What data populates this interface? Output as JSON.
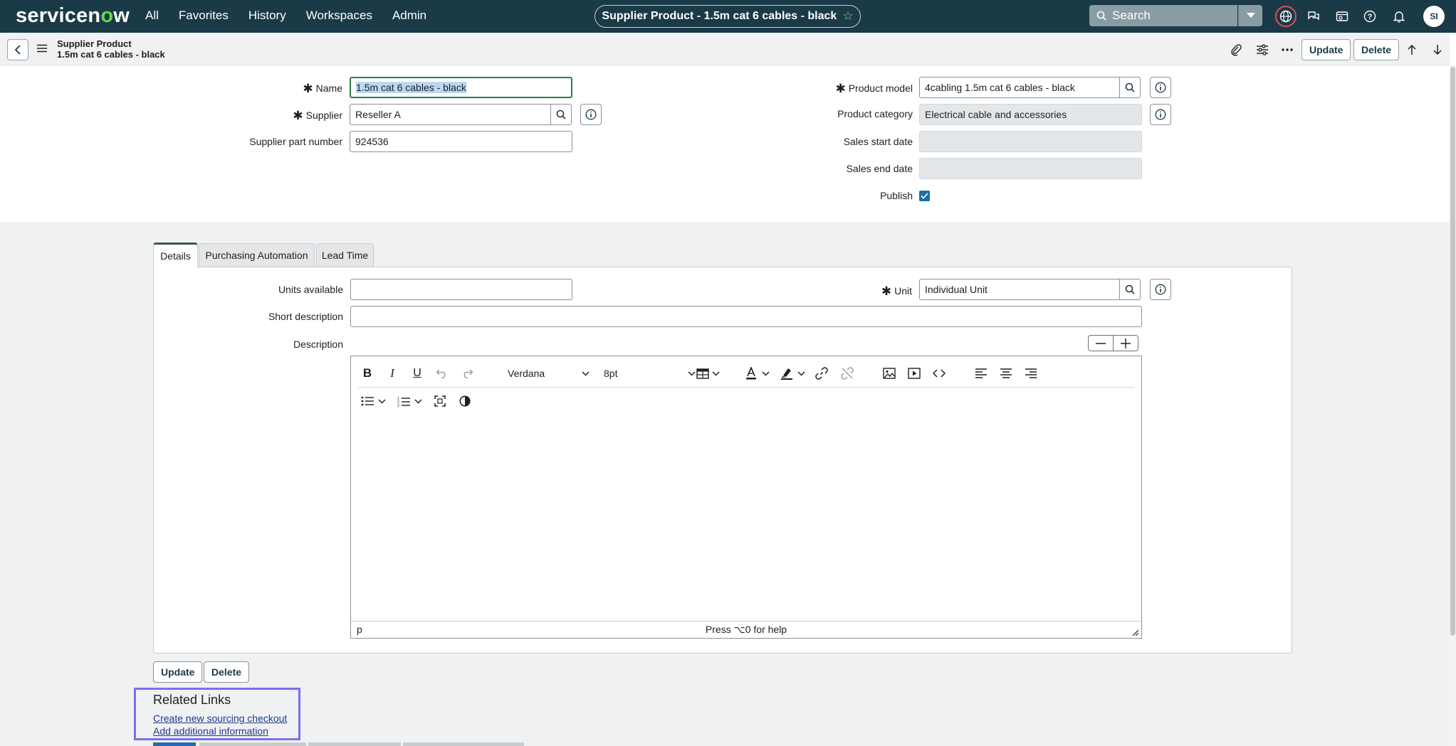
{
  "nav": {
    "logo_pre": "servicen",
    "logo_o": "o",
    "logo_post": "w",
    "links": [
      "All",
      "Favorites",
      "History",
      "Workspaces",
      "Admin"
    ],
    "title": "Supplier Product - 1.5m cat 6 cables - black",
    "search_placeholder": "Search",
    "avatar_initials": "SI"
  },
  "header": {
    "line1": "Supplier Product",
    "line2": "1.5m cat 6 cables - black",
    "update_label": "Update",
    "delete_label": "Delete"
  },
  "fields": {
    "name_label": "Name",
    "name_value": "1.5m cat 6 cables - black",
    "supplier_label": "Supplier",
    "supplier_value": "Reseller A",
    "supplier_part_label": "Supplier part number",
    "supplier_part_value": "924536",
    "product_model_label": "Product model",
    "product_model_value": "4cabling 1.5m cat 6 cables - black",
    "product_category_label": "Product category",
    "product_category_value": "Electrical cable and accessories",
    "sales_start_label": "Sales start date",
    "sales_end_label": "Sales end date",
    "publish_label": "Publish",
    "publish_checked": true
  },
  "tabs": [
    {
      "label": "Details",
      "active": true
    },
    {
      "label": "Purchasing Automation",
      "active": false
    },
    {
      "label": "Lead Time",
      "active": false
    }
  ],
  "details": {
    "units_available_label": "Units available",
    "unit_label": "Unit",
    "unit_value": "Individual Unit",
    "short_desc_label": "Short description",
    "description_label": "Description"
  },
  "editor": {
    "font": "Verdana",
    "size": "8pt",
    "path": "p",
    "help": "Press ⌥0 for help"
  },
  "bottom": {
    "update_label": "Update",
    "delete_label": "Delete"
  },
  "related_links": {
    "title": "Related Links",
    "links": [
      "Create new sourcing checkout",
      "Add additional information"
    ]
  },
  "colors": {
    "nav_bg": "#1b3a47",
    "accent_green": "#62d84e",
    "focus_border": "#2f7d46",
    "highlight_box": "#7a6ff0"
  }
}
